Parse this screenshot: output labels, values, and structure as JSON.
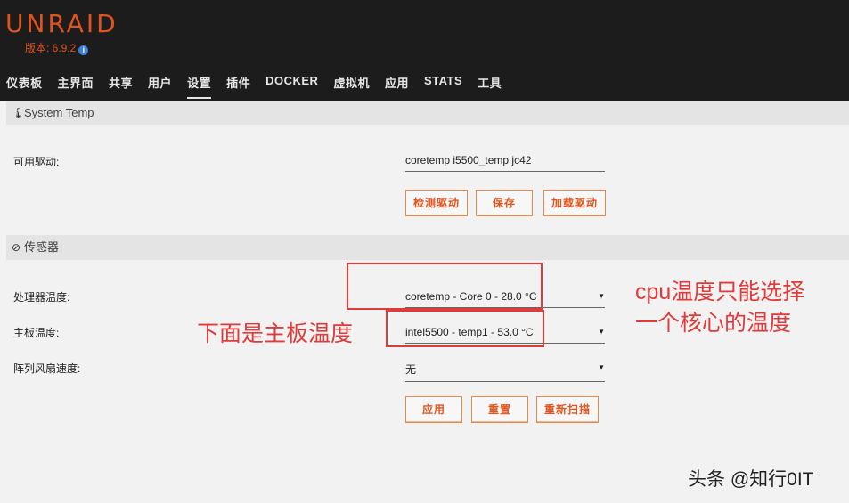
{
  "header": {
    "logo": "UNRAID",
    "version": "版本: 6.9.2"
  },
  "nav": {
    "items": [
      "仪表板",
      "主界面",
      "共享",
      "用户",
      "设置",
      "插件",
      "DOCKER",
      "虚拟机",
      "应用",
      "STATS",
      "工具"
    ],
    "active_index": 4
  },
  "system_temp": {
    "title": "System Temp",
    "drivers_label": "可用驱动:",
    "drivers_value": "coretemp i5500_temp jc42",
    "buttons": {
      "detect": "检测驱动",
      "save": "保存",
      "load": "加载驱动"
    }
  },
  "sensors": {
    "title": "传感器",
    "cpu_label": "处理器温度:",
    "cpu_value": "coretemp - Core 0 - 28.0 °C",
    "board_label": "主板温度:",
    "board_value": "intel5500 - temp1 - 53.0 °C",
    "fan_label": "阵列风扇速度:",
    "fan_value": "无",
    "buttons": {
      "apply": "应用",
      "reset": "重置",
      "rescan": "重新扫描"
    }
  },
  "annotations": {
    "board_note": "下面是主板温度",
    "cpu_note_line1": "cpu温度只能选择",
    "cpu_note_line2": "一个核心的温度",
    "watermark": "头条 @知行0IT",
    "accent_color": "#e03a3a"
  },
  "colors": {
    "brand": "#e0531c",
    "header_bg": "#1c1c1c"
  }
}
